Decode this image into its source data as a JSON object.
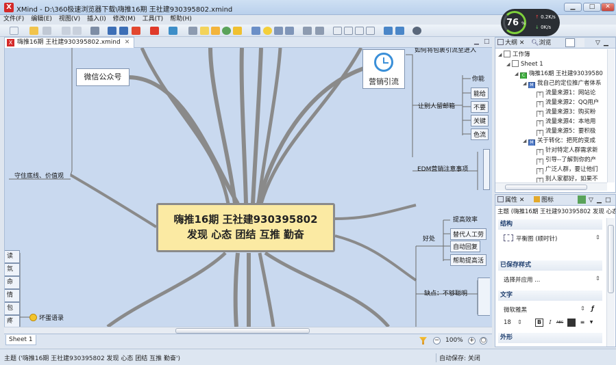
{
  "window": {
    "app_name": "XMind",
    "title": "XMind - D:\\360极速浏览器下载\\嗨推16期 王社建930395802.xmind",
    "buttons": {
      "minimize": "▁",
      "maximize": "□",
      "close": "✕"
    }
  },
  "menu": [
    {
      "label": "文件(F)"
    },
    {
      "label": "编辑(E)"
    },
    {
      "label": "视图(V)"
    },
    {
      "label": "插入(I)"
    },
    {
      "label": "修改(M)"
    },
    {
      "label": "工具(T)"
    },
    {
      "label": "帮助(H)"
    }
  ],
  "speed_widget": {
    "value": "76",
    "unit": "%",
    "up": "0.2K/s",
    "down": "0K/s",
    "ring_color": "#7fd13b"
  },
  "editor_tab": {
    "label": "嗨推16期 王社建930395802.xmind",
    "close": "✕"
  },
  "map": {
    "central": {
      "line1": "嗨推16期 王社建930395802",
      "line2": "发现 心态 团结 互推 勤奋"
    },
    "wechat": "微信公众号",
    "marketing": "营销引流",
    "bottom_line": "守住底线、价值观",
    "topics": {
      "how_to": "如何将包裹引流至进入",
      "let_mail": "让别人留邮箱",
      "you_can": "你能",
      "can_give": "能给",
      "dont": "不要",
      "key": "关键",
      "color": "色流",
      "edm": "EDM营销注意事项",
      "benefits": "好处",
      "efficiency": "提高效率",
      "replace_labor": "替代人工劳",
      "auto_reply": "自动回复",
      "help_improve": "帮助提高活",
      "drawback": "缺点：不够聪明"
    },
    "vertical_chars": [
      "读",
      "氛",
      "命",
      "情",
      "包",
      "疼"
    ],
    "smile_label": "坏蛋语录",
    "branch_color": "#8a8a8a"
  },
  "sheetbar": {
    "sheet_tab": "Sheet 1",
    "zoom": "100%",
    "zoom_out": "−",
    "zoom_in": "+",
    "zoom_fit": "○"
  },
  "status": {
    "text": "主题 ('嗨推16期 王社建930395802 发现 心态 团结 互推 勤奋')",
    "autosave": "自动保存: 关闭"
  },
  "outline_panel": {
    "tab_outline": "大纲",
    "tab_browse": "浏览",
    "close": "✕",
    "rows": [
      {
        "indent": 0,
        "twisty": "◢",
        "icon": "w",
        "label": "工作簿"
      },
      {
        "indent": 1,
        "twisty": "◢",
        "icon": "s",
        "label": "Sheet 1"
      },
      {
        "indent": 2,
        "twisty": "◢",
        "icon": "c",
        "label": "嗨推16期 王社建93039580"
      },
      {
        "indent": 3,
        "twisty": "◢",
        "icon": "m",
        "label": "我自己的定位推广者体系"
      },
      {
        "indent": 4,
        "twisty": "",
        "icon": "t",
        "label": "流量来源1：网站论"
      },
      {
        "indent": 4,
        "twisty": "",
        "icon": "t",
        "label": "流量来源2：QQ用户"
      },
      {
        "indent": 4,
        "twisty": "",
        "icon": "t",
        "label": "流量来源3：购买粉"
      },
      {
        "indent": 4,
        "twisty": "",
        "icon": "t",
        "label": "流量来源4：本地用"
      },
      {
        "indent": 4,
        "twisty": "",
        "icon": "t",
        "label": "流量来源5：要积极"
      },
      {
        "indent": 3,
        "twisty": "◢",
        "icon": "m",
        "label": "关于转化：把死的变成"
      },
      {
        "indent": 4,
        "twisty": "",
        "icon": "t",
        "label": "针对特定人群需求新"
      },
      {
        "indent": 4,
        "twisty": "",
        "icon": "t",
        "label": "引导--了解到你的产"
      },
      {
        "indent": 4,
        "twisty": "",
        "icon": "t",
        "label": "广泛人群，要让他们"
      },
      {
        "indent": 4,
        "twisty": "",
        "icon": "t",
        "label": "别人家都好，如果不"
      }
    ]
  },
  "props_panel": {
    "tab_props": "属性",
    "tab_icons": "图标",
    "close": "✕",
    "subject": "主题 (嗨推16期 王社建930395802 发现 心态",
    "sec_structure": "结构",
    "structure_value": "平衡图 (顺时针)",
    "sec_saved_style": "已保存样式",
    "saved_style_value": "选择并应用 ...",
    "sec_text": "文字",
    "font_name": "微软雅黑",
    "font_size": "18",
    "bold": "B",
    "italic": "I",
    "strike": "ABC",
    "sec_shape": "外形"
  }
}
